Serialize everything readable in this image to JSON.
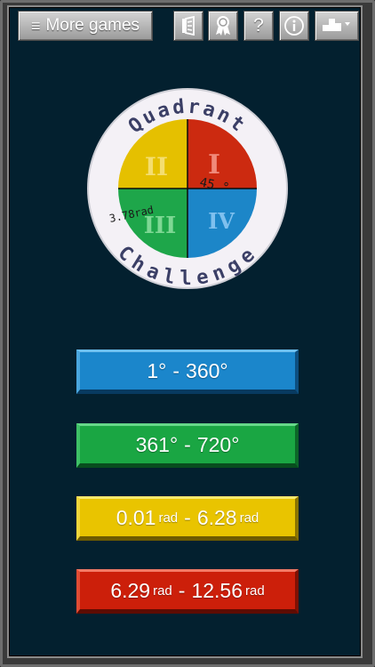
{
  "toolbar": {
    "more_games_label": "More games",
    "help_label": "?",
    "icons": [
      "menu-icon",
      "theory-book-icon",
      "achievement-ribbon-icon",
      "help-icon",
      "info-icon",
      "leaderboard-podium-icon"
    ]
  },
  "logo": {
    "title_top": "Quadrant",
    "title_bottom": "Challenge",
    "quadrants": {
      "I": {
        "numeral": "I",
        "color": "#cc2a10"
      },
      "II": {
        "numeral": "II",
        "color": "#e5c000"
      },
      "III": {
        "numeral": "III",
        "color": "#1ea64a"
      },
      "IV": {
        "numeral": "IV",
        "color": "#1c86c8"
      }
    },
    "sample_degree": "45 °",
    "sample_radian": "3.78rad"
  },
  "ranges": [
    {
      "start": "1°",
      "start_unit": "",
      "sep": "-",
      "end": "360°",
      "end_unit": "",
      "color": "#1b86cb"
    },
    {
      "start": "361°",
      "start_unit": "",
      "sep": "-",
      "end": "720°",
      "end_unit": "",
      "color": "#1aa643"
    },
    {
      "start": "0.01",
      "start_unit": "rad",
      "sep": "-",
      "end": "6.28",
      "end_unit": "rad",
      "color": "#e9c400"
    },
    {
      "start": "6.29",
      "start_unit": "rad",
      "sep": "-",
      "end": "12.56",
      "end_unit": "rad",
      "color": "#cc1f0a"
    }
  ],
  "colors": {
    "background": "#03202f",
    "frame": "#3a3a3a"
  }
}
